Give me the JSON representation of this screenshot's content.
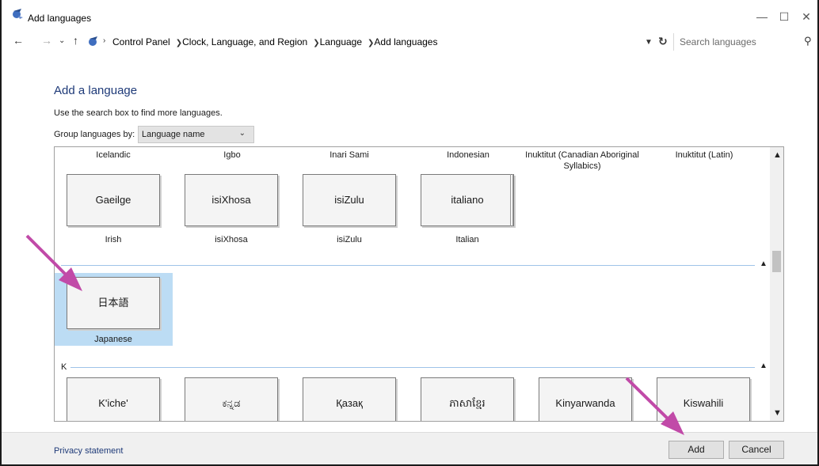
{
  "window": {
    "title": "Add languages",
    "app_icon": "language-globe-icon",
    "controls": {
      "minimize": "—",
      "maximize": "☐",
      "close": "✕"
    }
  },
  "address_bar": {
    "breadcrumbs": [
      "Control Panel",
      "Clock, Language, and Region",
      "Language",
      "Add languages"
    ],
    "search_placeholder": "Search languages"
  },
  "content": {
    "heading": "Add a language",
    "hint": "Use the search box to find more languages.",
    "group_by_label": "Group languages by:",
    "group_by_value": "Language name"
  },
  "language_list": {
    "partial_top_row": [
      "Icelandic",
      "Igbo",
      "Inari Sami",
      "Indonesian",
      "Inuktitut (Canadian Aboriginal Syllabics)",
      "Inuktitut (Latin)"
    ],
    "i_row": [
      {
        "native": "Gaeilge",
        "english": "Irish"
      },
      {
        "native": "isiXhosa",
        "english": "isiXhosa"
      },
      {
        "native": "isiZulu",
        "english": "isiZulu"
      },
      {
        "native": "italiano",
        "english": "Italian"
      }
    ],
    "j_group": {
      "letter": "",
      "items": [
        {
          "native": "日本語",
          "english": "Japanese",
          "selected": true
        }
      ]
    },
    "k_group": {
      "letter": "K",
      "items": [
        {
          "native": "K'iche'"
        },
        {
          "native": "ಕನ್ನಡ"
        },
        {
          "native": "Қазақ"
        },
        {
          "native": "ភាសាខ្មែរ"
        },
        {
          "native": "Kinyarwanda"
        },
        {
          "native": "Kiswahili"
        }
      ]
    }
  },
  "footer": {
    "privacy_link": "Privacy statement",
    "add_button": "Add",
    "cancel_button": "Cancel"
  },
  "annotation_colors": {
    "arrow": "#c14aa8"
  }
}
